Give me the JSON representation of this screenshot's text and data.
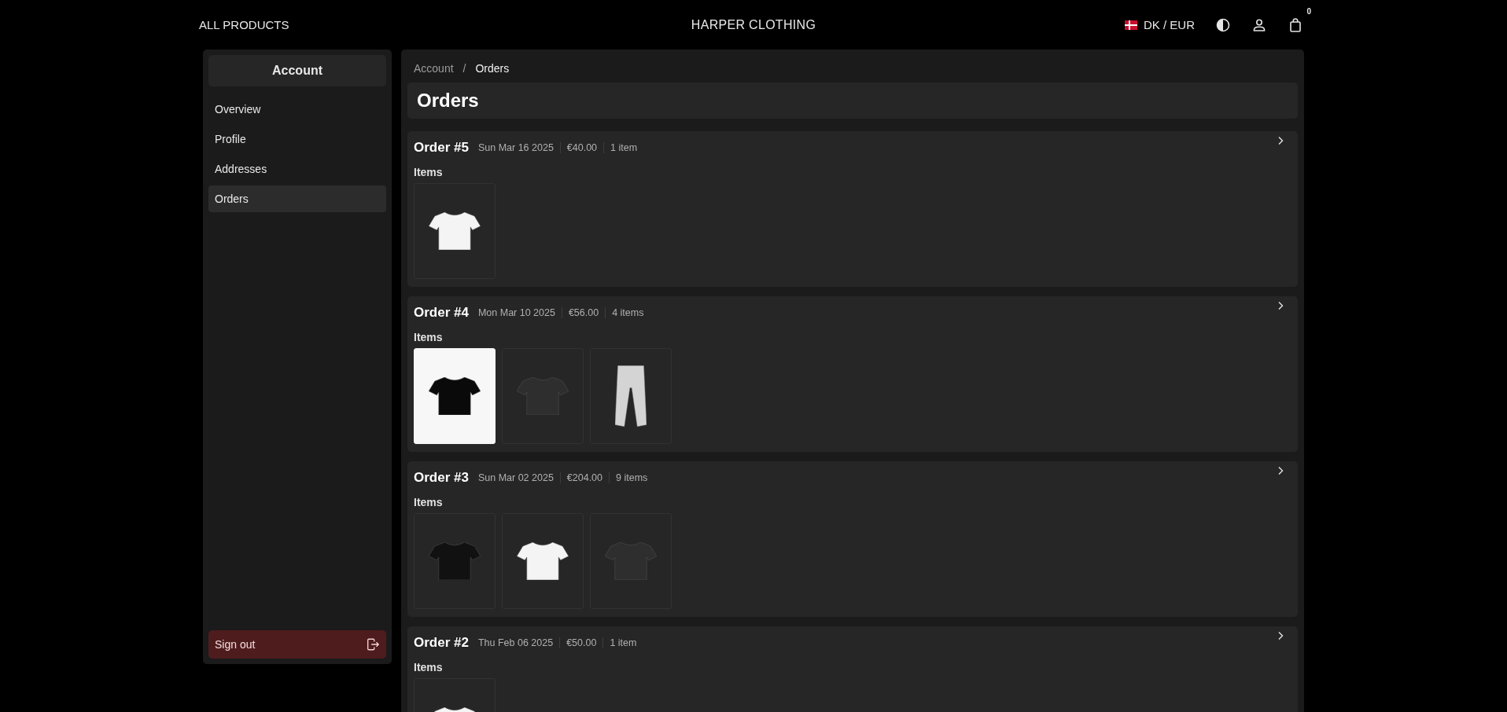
{
  "header": {
    "nav_link": "ALL PRODUCTS",
    "brand": "HARPER CLOTHING",
    "locale": "DK / EUR",
    "cart_count": "0"
  },
  "sidebar": {
    "title": "Account",
    "items": [
      {
        "label": "Overview",
        "selected": false
      },
      {
        "label": "Profile",
        "selected": false
      },
      {
        "label": "Addresses",
        "selected": false
      },
      {
        "label": "Orders",
        "selected": true
      }
    ],
    "sign_out": "Sign out"
  },
  "breadcrumb": [
    {
      "label": "Account",
      "current": false
    },
    {
      "label": "Orders",
      "current": true
    }
  ],
  "breadcrumb_separator": "/",
  "page_title": "Orders",
  "orders": [
    {
      "title": "Order #5",
      "date": "Sun Mar 16 2025",
      "total": "€40.00",
      "count": "1 item",
      "items_label": "Items",
      "items": [
        {
          "kind": "tee",
          "color": "#f4f4f4",
          "light_backdrop": false
        }
      ]
    },
    {
      "title": "Order #4",
      "date": "Mon Mar 10 2025",
      "total": "€56.00",
      "count": "4 items",
      "items_label": "Items",
      "items": [
        {
          "kind": "tee",
          "color": "#0a0a0a",
          "light_backdrop": true
        },
        {
          "kind": "tee",
          "color": "#2e2e2e",
          "light_backdrop": false
        },
        {
          "kind": "pants",
          "color": "#d4d4d4",
          "light_backdrop": false
        }
      ]
    },
    {
      "title": "Order #3",
      "date": "Sun Mar 02 2025",
      "total": "€204.00",
      "count": "9 items",
      "items_label": "Items",
      "items": [
        {
          "kind": "tee",
          "color": "#111111",
          "light_backdrop": false
        },
        {
          "kind": "tee",
          "color": "#f4f4f4",
          "light_backdrop": false
        },
        {
          "kind": "tee",
          "color": "#2e2e2e",
          "light_backdrop": false
        }
      ]
    },
    {
      "title": "Order #2",
      "date": "Thu Feb 06 2025",
      "total": "€50.00",
      "count": "1 item",
      "items_label": "Items",
      "items": [
        {
          "kind": "tee",
          "color": "#f4f4f4",
          "light_backdrop": false
        }
      ]
    }
  ]
}
